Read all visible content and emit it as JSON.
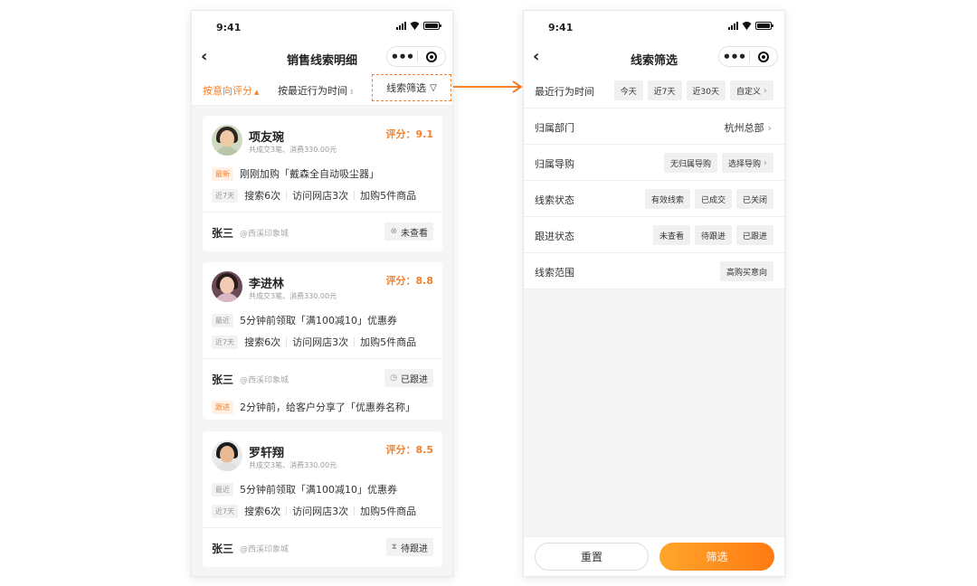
{
  "colors": {
    "accent": "#f5812a",
    "button_gradient": [
      "#ffa62b",
      "#ff7a12"
    ]
  },
  "list_page": {
    "status_time": "9:41",
    "title": "销售线索明细",
    "sort_score": "按意向评分",
    "sort_time": "按最近行为时间",
    "filter_label": "线索筛选",
    "cards": [
      {
        "name": "项友琬",
        "deals": "共成交3笔、消费330.00元",
        "score": "评分：9.1",
        "event_tag": "最新",
        "event": "刚刚加购「戴森全自动吸尘器」",
        "week_tag": "近7天",
        "metrics": [
          "搜索6次",
          "访问网店3次",
          "加购5件商品"
        ],
        "staff": "张三",
        "store": "@西溪印象城",
        "state": "未查看"
      },
      {
        "name": "李进林",
        "deals": "共成交3笔、消费330.00元",
        "score": "评分：8.8",
        "event_tag": "最近",
        "event": "5分钟前领取「满100减10」优惠券",
        "week_tag": "近7天",
        "metrics": [
          "搜索6次",
          "访问网店3次",
          "加购5件商品"
        ],
        "staff": "张三",
        "store": "@西溪印象城",
        "state": "已跟进",
        "follow_tag": "跟进",
        "follow_text": "2分钟前，给客户分享了「优惠券名称」"
      },
      {
        "name": "罗轩翔",
        "deals": "共成交3笔、消费330.00元",
        "score": "评分：8.5",
        "event_tag": "最近",
        "event": "5分钟前领取「满100减10」优惠券",
        "week_tag": "近7天",
        "metrics": [
          "搜索6次",
          "访问网店3次",
          "加购5件商品"
        ],
        "staff": "张三",
        "store": "@西溪印象城",
        "state": "待跟进"
      }
    ]
  },
  "filter_page": {
    "status_time": "9:41",
    "title": "线索筛选",
    "rows": [
      {
        "label": "最近行为时间",
        "chips": [
          "今天",
          "近7天",
          "近30天",
          "自定义"
        ]
      },
      {
        "label": "归属部门",
        "value": "杭州总部"
      },
      {
        "label": "归属导购",
        "chips": [
          "无归属导购",
          "选择导购"
        ]
      },
      {
        "label": "线索状态",
        "chips": [
          "有效线索",
          "已成交",
          "已关闭"
        ]
      },
      {
        "label": "跟进状态",
        "chips": [
          "未查看",
          "待跟进",
          "已跟进"
        ]
      },
      {
        "label": "线索范围",
        "chips": [
          "高购买意向"
        ]
      }
    ],
    "reset_label": "重置",
    "apply_label": "筛选"
  }
}
